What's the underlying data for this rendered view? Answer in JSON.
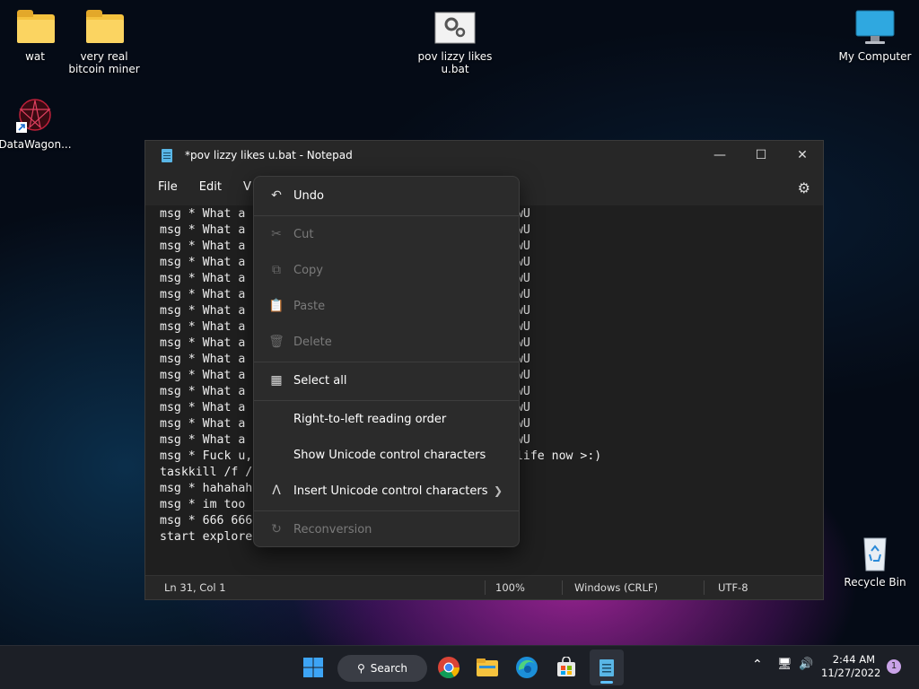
{
  "desktop": {
    "icons": [
      {
        "label": "wat"
      },
      {
        "label": "very real bitcoin miner"
      },
      {
        "label": "pov lizzy likes u.bat"
      },
      {
        "label": "My Computer"
      },
      {
        "label": "DataWagon..."
      },
      {
        "label": "Recycle Bin"
      }
    ]
  },
  "notepad": {
    "title": "*pov lizzy likes u.bat - Notepad",
    "menu": {
      "file": "File",
      "edit": "Edit",
      "view": "V"
    },
    "editor_text": "msg * What a                              uck it UwU\nmsg * What a                              uck it UwU\nmsg * What a                              uck it UwU\nmsg * What a                              uck it UwU\nmsg * What a                              uck it UwU\nmsg * What a                              uck it UwU\nmsg * What a                              uck it UwU\nmsg * What a                              uck it UwU\nmsg * What a                              uck it UwU\nmsg * What a                              uck it UwU\nmsg * What a                              uck it UwU\nmsg * What a                              uck it UwU\nmsg * What a                              uck it UwU\nmsg * What a                              uck it UwU\nmsg * What a                              uck it UwU\nmsg * Fuck u,                              end ur life now >:)\ntaskkill /f /\nmsg * hahahah\nmsg * im too\nmsg * 666 666                            666\nstart explore",
    "status": {
      "position": "Ln 31, Col 1",
      "zoom": "100%",
      "line_ending": "Windows (CRLF)",
      "encoding": "UTF-8"
    }
  },
  "context_menu": {
    "undo": "Undo",
    "cut": "Cut",
    "copy": "Copy",
    "paste": "Paste",
    "delete": "Delete",
    "select_all": "Select all",
    "rtl": "Right-to-left reading order",
    "show_unicode": "Show Unicode control characters",
    "insert_unicode": "Insert Unicode control characters",
    "reconversion": "Reconversion"
  },
  "taskbar": {
    "search_label": "Search",
    "time": "2:44 AM",
    "date": "11/27/2022",
    "notification_count": "1"
  }
}
